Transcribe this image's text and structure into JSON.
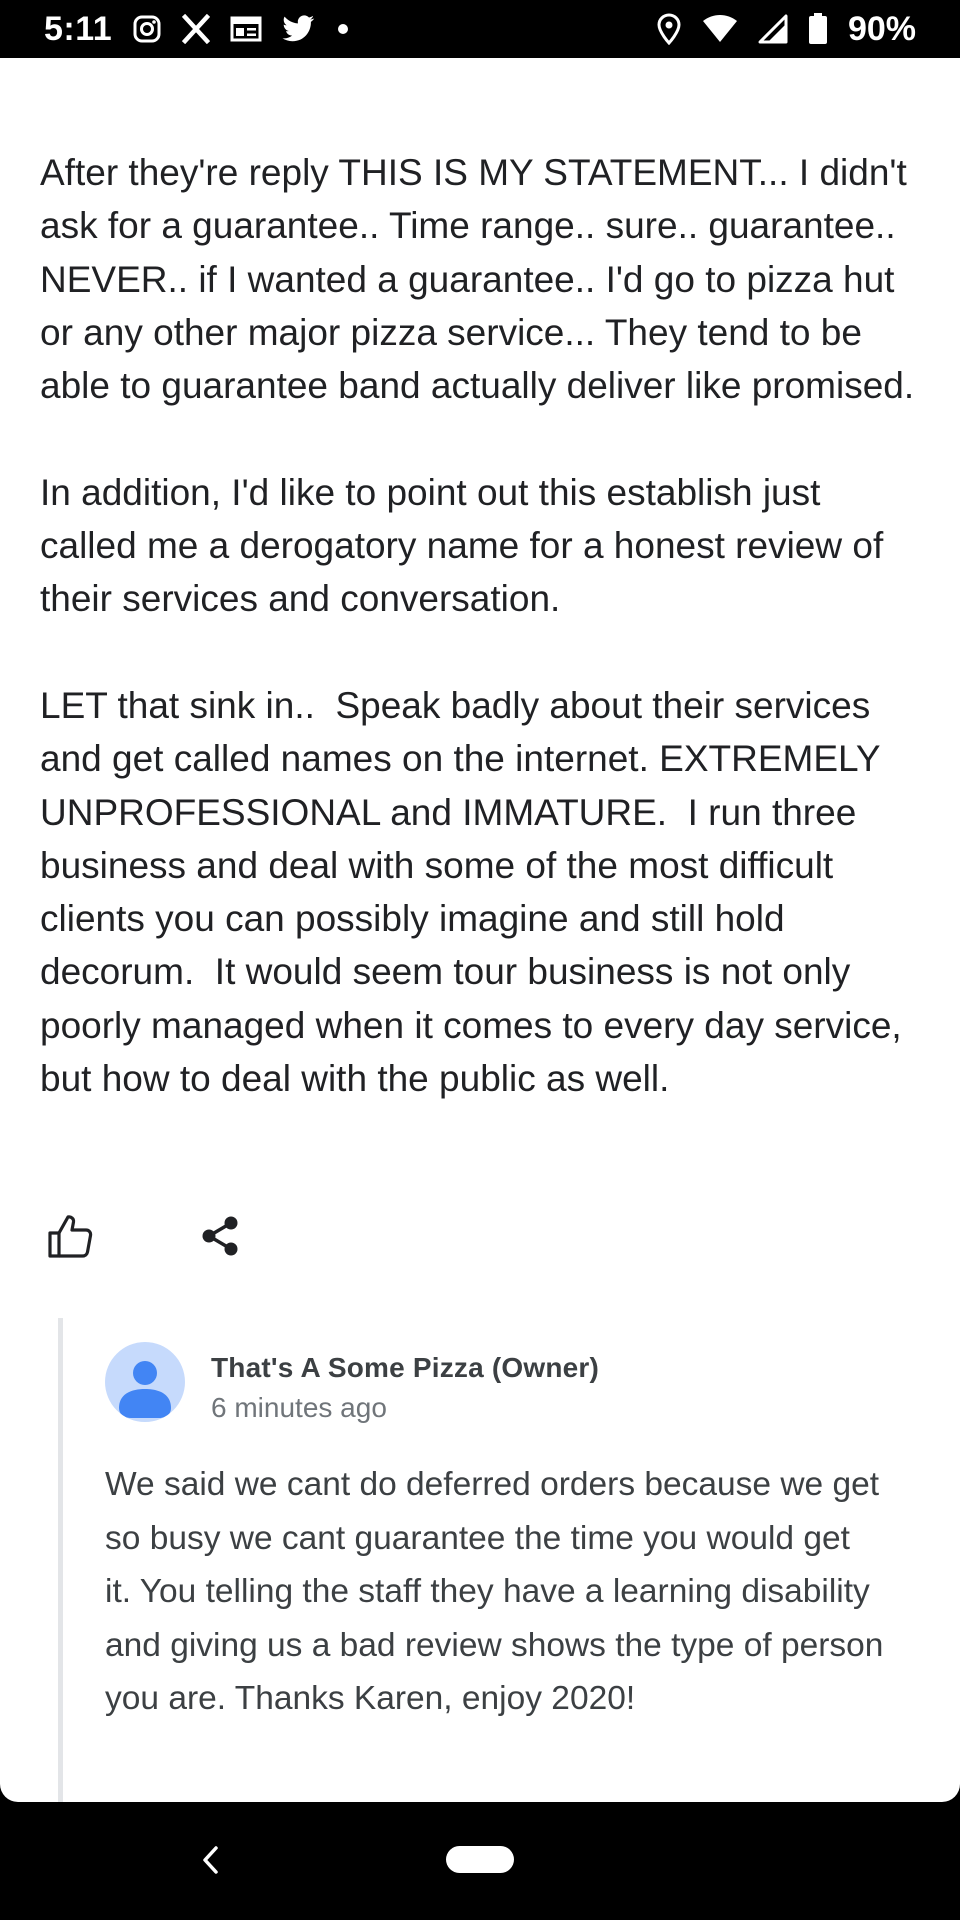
{
  "status_bar": {
    "time": "5:11",
    "battery": "90%",
    "left_icons": [
      "instagram-icon",
      "x-icon",
      "news-icon",
      "twitter-icon",
      "dot-icon"
    ],
    "right_icons": [
      "location-icon",
      "wifi-icon",
      "signal-icon",
      "battery-icon"
    ]
  },
  "review": {
    "paragraphs": [
      "After they're reply THIS IS MY STATEMENT... I didn't ask for a guarantee.. Time range.. sure.. guarantee.. NEVER.. if I wanted a guarantee.. I'd go to pizza hut or any other major pizza service... They tend to be able to guarantee band actually deliver like promised.",
      "In addition, I'd like to point out this establish just called me a derogatory name for a honest review of their services and conversation.",
      "LET that sink in..  Speak badly about their services and get called names on the internet. EXTREMELY UNPROFESSIONAL and IMMATURE.  I run three business and deal with some of the most difficult clients you can possibly imagine and still hold decorum.  It would seem tour business is not only poorly managed when it comes to every day service, but how to deal with the public as well."
    ]
  },
  "actions": {
    "like_icon": "thumbs-up-icon",
    "share_icon": "share-icon"
  },
  "owner_reply": {
    "author": "That's A Some Pizza (Owner)",
    "time": "6 minutes ago",
    "text": "We said we cant do deferred orders because we get so busy we cant guarantee the time you would get it. You telling the staff they have a learning disability and giving us a bad review shows the type of person you are. Thanks Karen, enjoy 2020!"
  },
  "colors": {
    "text": "#202124",
    "reply_text": "#3c4043",
    "muted": "#70757a",
    "avatar_bg": "#c6dafc",
    "avatar_fg": "#4285f4"
  }
}
